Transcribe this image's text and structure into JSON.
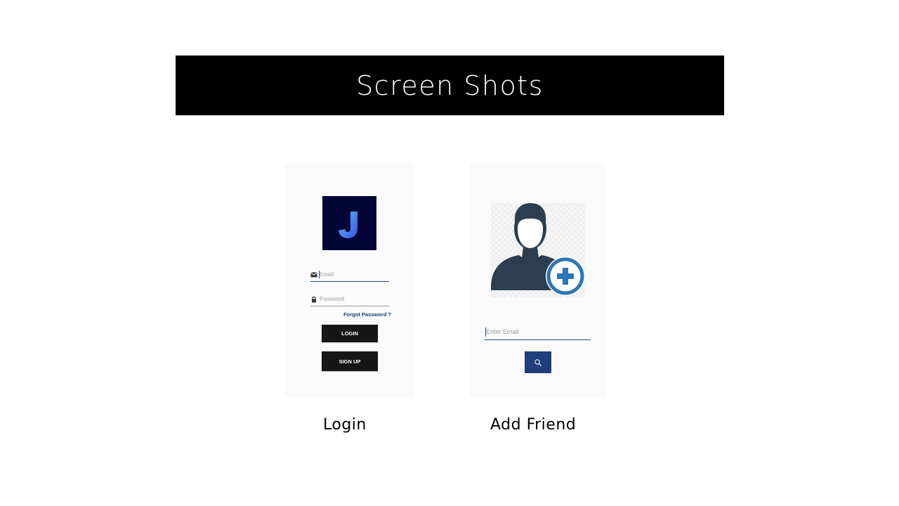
{
  "banner": {
    "title": "Screen Shots"
  },
  "login_screen": {
    "logo_letter": "J",
    "email_placeholder": "Email",
    "password_placeholder": "Password",
    "forgot_password": "Forgot Password ?",
    "login_button": "LOGIN",
    "signup_button": "SIGN UP",
    "icons": [
      "mail-icon",
      "lock-icon"
    ],
    "caption": "Login"
  },
  "add_friend_screen": {
    "avatar_icon": "add-user-icon",
    "email_placeholder": "Enter Email",
    "search_icon": "search-icon",
    "caption": "Add Friend"
  },
  "colors": {
    "banner_bg": "#000000",
    "logo_bg": "#030537",
    "accent_blue": "#1f3f7c",
    "avatar_dark": "#2c3e50",
    "plus_blue": "#2e75b6"
  }
}
